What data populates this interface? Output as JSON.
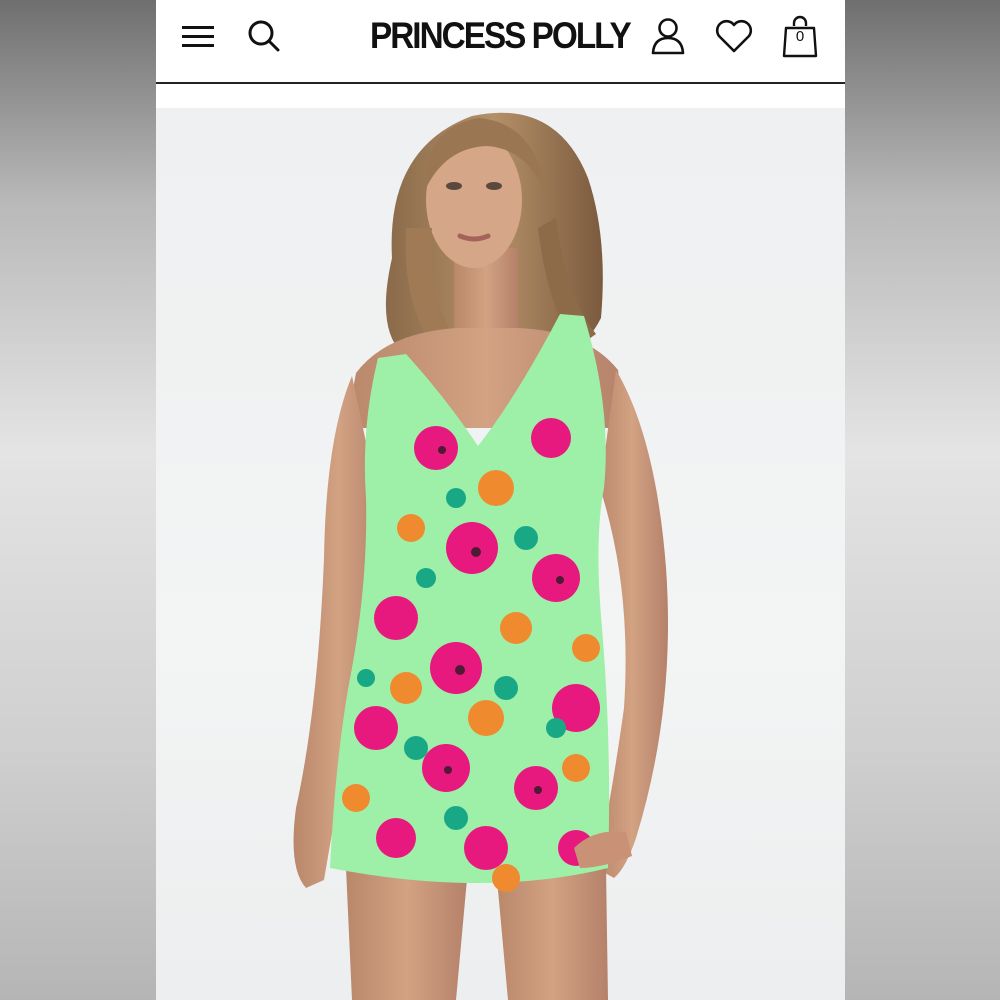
{
  "header": {
    "brand": "PRINCESS POLLY",
    "cart_count": "0",
    "icons": [
      "menu-icon",
      "search-icon",
      "account-icon",
      "wishlist-icon",
      "bag-icon"
    ]
  },
  "product_image": {
    "subject": "model-in-floral-mini-dress"
  },
  "colors": {
    "header_bg": "#ffffff",
    "divider": "#222222",
    "brand_text": "#111111",
    "photo_bg": "#f0f1f2",
    "dress_green": "#8ee89a",
    "dress_pink": "#e8197e",
    "dress_orange": "#f08a2e"
  }
}
